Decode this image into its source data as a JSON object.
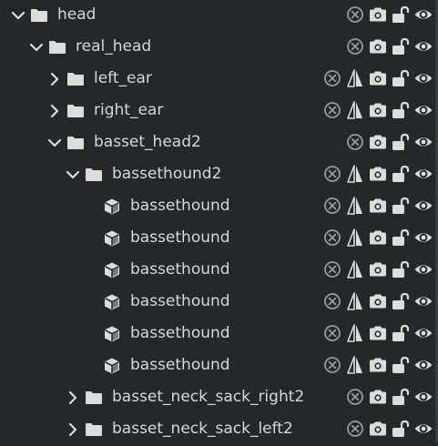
{
  "tree": {
    "nodes": [
      {
        "label": "head",
        "depth": 0,
        "toggle": "expanded",
        "icon": "folder-icon",
        "controls": [
          "clear-icon",
          "camera-icon",
          "lock-icon",
          "eye-icon"
        ]
      },
      {
        "label": "real_head",
        "depth": 1,
        "toggle": "expanded",
        "icon": "folder-icon",
        "controls": [
          "clear-icon",
          "camera-icon",
          "lock-icon",
          "eye-icon"
        ]
      },
      {
        "label": "left_ear",
        "depth": 2,
        "toggle": "collapsed",
        "icon": "folder-icon",
        "controls": [
          "clear-icon",
          "mirror-icon",
          "camera-icon",
          "lock-icon",
          "eye-icon"
        ]
      },
      {
        "label": "right_ear",
        "depth": 2,
        "toggle": "collapsed",
        "icon": "folder-icon",
        "controls": [
          "clear-icon",
          "mirror-icon",
          "camera-icon",
          "lock-icon",
          "eye-icon"
        ]
      },
      {
        "label": "basset_head2",
        "depth": 2,
        "toggle": "expanded",
        "icon": "folder-icon",
        "controls": [
          "clear-icon",
          "camera-icon",
          "lock-icon",
          "eye-icon"
        ]
      },
      {
        "label": "bassethound2",
        "depth": 3,
        "toggle": "expanded",
        "icon": "folder-icon",
        "controls": [
          "clear-icon",
          "mirror-icon",
          "camera-icon",
          "lock-icon",
          "eye-icon"
        ]
      },
      {
        "label": "bassethound",
        "depth": 4,
        "toggle": "none",
        "icon": "cube-icon",
        "controls": [
          "clear-icon",
          "mirror-icon",
          "camera-icon",
          "lock-icon",
          "eye-icon"
        ]
      },
      {
        "label": "bassethound",
        "depth": 4,
        "toggle": "none",
        "icon": "cube-icon",
        "controls": [
          "clear-icon",
          "mirror-icon",
          "camera-icon",
          "lock-icon",
          "eye-icon"
        ]
      },
      {
        "label": "bassethound",
        "depth": 4,
        "toggle": "none",
        "icon": "cube-icon",
        "controls": [
          "clear-icon",
          "mirror-icon",
          "camera-icon",
          "lock-icon",
          "eye-icon"
        ]
      },
      {
        "label": "bassethound",
        "depth": 4,
        "toggle": "none",
        "icon": "cube-icon",
        "controls": [
          "clear-icon",
          "mirror-icon",
          "camera-icon",
          "lock-icon",
          "eye-icon"
        ]
      },
      {
        "label": "bassethound",
        "depth": 4,
        "toggle": "none",
        "icon": "cube-icon",
        "controls": [
          "clear-icon",
          "mirror-icon",
          "camera-icon",
          "lock-icon",
          "eye-icon"
        ]
      },
      {
        "label": "bassethound",
        "depth": 4,
        "toggle": "none",
        "icon": "cube-icon",
        "controls": [
          "clear-icon",
          "mirror-icon",
          "camera-icon",
          "lock-icon",
          "eye-icon"
        ]
      },
      {
        "label": "basset_neck_sack_right2",
        "depth": 3,
        "toggle": "collapsed",
        "icon": "folder-icon",
        "controls": [
          "clear-icon",
          "camera-icon",
          "lock-icon",
          "eye-icon"
        ]
      },
      {
        "label": "basset_neck_sack_left2",
        "depth": 3,
        "toggle": "collapsed",
        "icon": "folder-icon",
        "controls": [
          "clear-icon",
          "camera-icon",
          "lock-icon",
          "eye-icon"
        ]
      }
    ]
  },
  "colors": {
    "background": "#26272b",
    "text": "#d8d8d8",
    "icon": "#dcdcdc",
    "icon_dim": "#9a9a9a"
  }
}
